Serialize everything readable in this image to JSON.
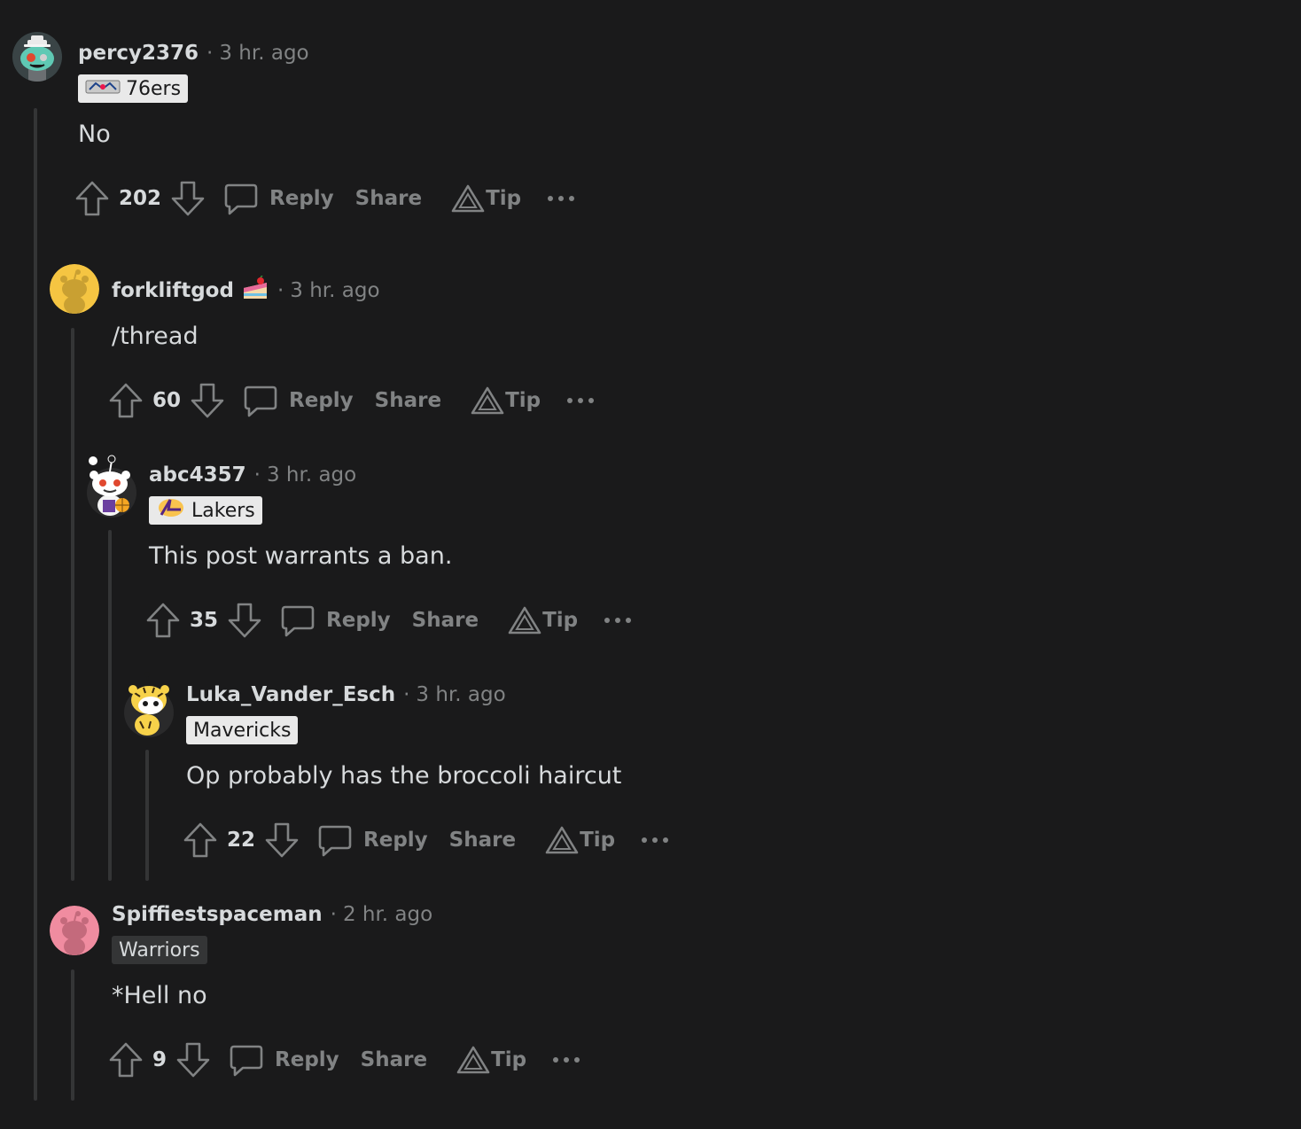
{
  "actions": {
    "reply": "Reply",
    "share": "Share",
    "tip": "Tip",
    "more": "···"
  },
  "meta_separator": "·",
  "comments": [
    {
      "username": "percy2376",
      "time": "3 hr. ago",
      "flair": "76ers",
      "body": "No",
      "votes": "202",
      "avatar_icon": "zombie-snoo-avatar"
    },
    {
      "username": "forkliftgod",
      "time": "3 hr. ago",
      "flair": null,
      "body": "/thread",
      "votes": "60",
      "avatar_icon": "default-snoo-avatar-yellow",
      "badge_icon": "cake-day-icon"
    },
    {
      "username": "abc4357",
      "time": "3 hr. ago",
      "flair": "Lakers",
      "body": "This post warrants a ban.",
      "votes": "35",
      "avatar_icon": "snoo-lakers-avatar"
    },
    {
      "username": "Luka_Vander_Esch",
      "time": "3 hr. ago",
      "flair": "Mavericks",
      "body": "Op probably has the broccoli haircut",
      "votes": "22",
      "avatar_icon": "snoo-tiger-avatar"
    },
    {
      "username": "Spiffiestspaceman",
      "time": "2 hr. ago",
      "flair": "Warriors",
      "body": "*Hell no",
      "votes": "9",
      "avatar_icon": "default-snoo-avatar-pink"
    }
  ],
  "colors": {
    "background": "#1a1a1b",
    "text": "#d7dadc",
    "muted": "#818384",
    "thread_line": "#343536",
    "flair_light": "#e9e9e9",
    "flair_dark": "#343536"
  }
}
